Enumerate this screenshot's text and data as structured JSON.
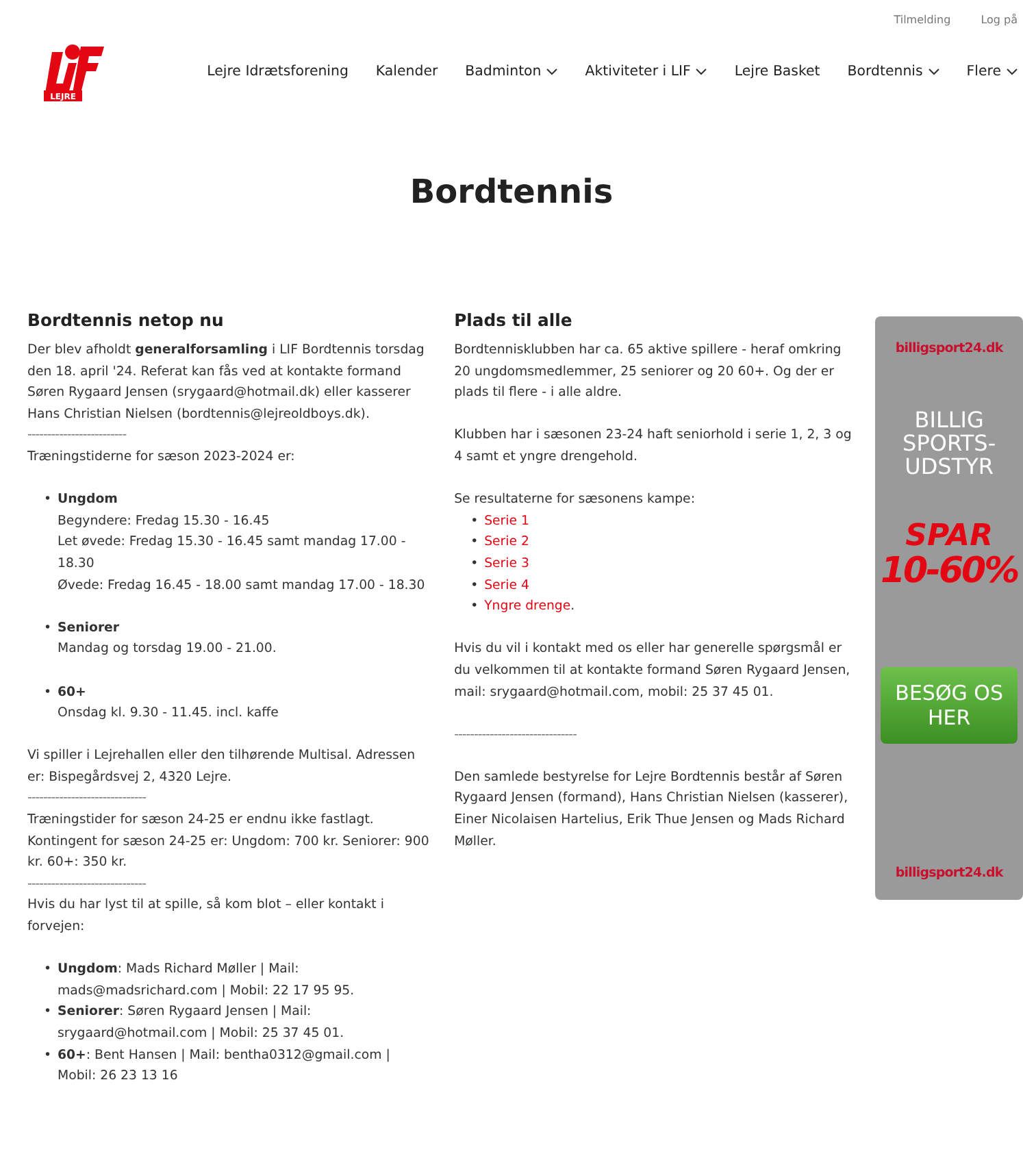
{
  "top_links": [
    "Tilmelding",
    "Log på"
  ],
  "logo": {
    "text": "LEJRE"
  },
  "nav": [
    {
      "label": "Lejre Idrætsforening",
      "dropdown": false
    },
    {
      "label": "Kalender",
      "dropdown": false
    },
    {
      "label": "Badminton",
      "dropdown": true
    },
    {
      "label": "Aktiviteter i LIF",
      "dropdown": true
    },
    {
      "label": "Lejre Basket",
      "dropdown": false
    },
    {
      "label": "Bordtennis",
      "dropdown": true
    },
    {
      "label": "Flere",
      "dropdown": true
    }
  ],
  "page_title": "Bordtennis",
  "left": {
    "heading": "Bordtennis netop nu",
    "blocks": [
      {
        "kind": "paragraph",
        "text": "Der blev afholdt **generalforsamling** i LIF Bordtennis torsdag den 18. april '24. Referat kan fås ved at kontakte formand Søren Rygaard Jensen (srygaard@hotmail.dk) eller kasserer Hans Christian Nielsen (bordtennis@lejreoldboys.dk)."
      },
      {
        "kind": "rule",
        "text": "-------------------------"
      },
      {
        "kind": "paragraph",
        "text": "Træningstiderne for sæson 2023-2024 er:"
      },
      {
        "kind": "schedule",
        "marker": "•",
        "items": [
          {
            "title": "Ungdom",
            "lines": [
              "Begyndere: Fredag 15.30 - 16.45",
              "Let øvede: Fredag 15.30 - 16.45 samt mandag 17.00 - 18.30",
              "Øvede: Fredag 16.45 - 18.00 samt mandag 17.00 - 18.30"
            ]
          },
          {
            "title": "Seniorer",
            "lines": [
              "Mandag og torsdag 19.00 - 21.00."
            ]
          },
          {
            "title": "60+",
            "lines": [
              "Onsdag kl. 9.30 - 11.45. incl. kaffe"
            ]
          }
        ]
      },
      {
        "kind": "paragraph",
        "text": "Vi spiller i Lejrehallen eller den tilhørende Multisal. Adressen er: Bispegårdsvej 2, 4320 Lejre."
      },
      {
        "kind": "rule",
        "text": "------------------------------"
      },
      {
        "kind": "paragraph",
        "text": "Træningstider for sæson 24-25 er endnu ikke fastlagt. Kontingent for sæson 24-25 er: Ungdom: 700 kr. Seniorer: 900 kr. 60+: 350 kr."
      },
      {
        "kind": "rule",
        "text": "------------------------------"
      },
      {
        "kind": "paragraph",
        "text": "Hvis du har lyst til at spille, så kom blot – eller kontakt i forvejen:"
      },
      {
        "kind": "contacts",
        "marker": "•",
        "items": [
          "**Ungdom**: Mads Richard Møller | Mail: mads@madsrichard.com | Mobil: 22 17 95 95.",
          "**Seniorer**: Søren Rygaard Jensen | Mail: srygaard@hotmail.com | Mobil: 25 37 45 01.",
          "**60+**: Bent Hansen | Mail: bentha0312@gmail.com | Mobil: 26 23 13 16"
        ]
      }
    ]
  },
  "middle": {
    "heading": "Plads til alle",
    "blocks": [
      {
        "kind": "paragraph",
        "text": "Bordtennisklubben har ca. 65 aktive spillere - heraf omkring 20 ungdomsmedlemmer, 25 seniorer og 20 60+. Og der er plads til flere - i alle aldre."
      },
      {
        "kind": "paragraph",
        "text": "Klubben har i sæsonen 23-24 haft seniorhold i serie 1, 2, 3 og 4 samt et yngre drengehold."
      },
      {
        "kind": "paragraph",
        "text": "Se resultaterne for sæsonens kampe:"
      },
      {
        "kind": "links",
        "marker": "•",
        "items": [
          {
            "label": "Serie 1"
          },
          {
            "label": "Serie 2"
          },
          {
            "label": "Serie 3"
          },
          {
            "label": "Serie 4"
          },
          {
            "label": "Yngre drenge",
            "suffix": "."
          }
        ]
      },
      {
        "kind": "paragraph",
        "text": "Hvis du vil i kontakt med os eller har generelle spørgsmål er du velkommen til at kontakte formand Søren Rygaard Jensen, mail: srygaard@hotmail.com, mobil: 25 37 45 01."
      },
      {
        "kind": "rule",
        "text": "-------------------------------"
      },
      {
        "kind": "paragraph",
        "text": "Den samlede bestyrelse for Lejre Bordtennis består af Søren Rygaard Jensen (formand), Hans Christian Nielsen (kasserer), Einer Nicolaisen Hartelius, Erik Thue Jensen og Mads Richard Møller."
      }
    ]
  },
  "ad": {
    "brand": "billigsport24.dk",
    "tagline": "BILLIG SPORTS-UDSTYR",
    "offer_top": "SPAR",
    "offer": "10-60%",
    "button": "BESØG OS HER",
    "brand_bottom": "billigsport24.dk"
  }
}
